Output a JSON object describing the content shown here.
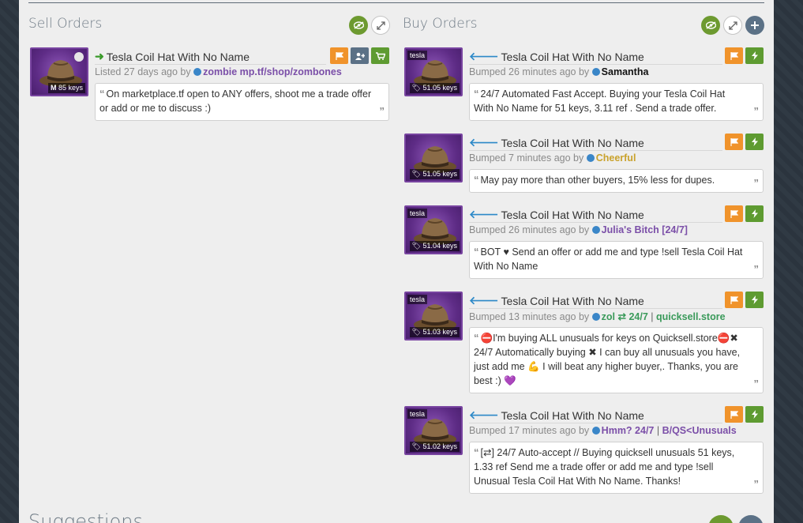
{
  "sell_orders": {
    "title": "Sell Orders",
    "listings": [
      {
        "item_name": "Tesla Coil Hat With No Name",
        "price": "85 keys",
        "price_prefix": "M",
        "status_prefix": "Listed 27 days ago by",
        "user": "zombie mp.tf/shop/zombones",
        "user_color": "#7b4fa8",
        "message": "On marketplace.tf open to ANY offers, shoot me a trade offer or add or me to discuss :)"
      }
    ]
  },
  "buy_orders": {
    "title": "Buy Orders",
    "listings": [
      {
        "tag": "tesla",
        "item_name": "Tesla Coil Hat With No Name",
        "price": "51.05 keys",
        "status_prefix": "Bumped 26 minutes ago by",
        "user": "Samantha",
        "user_color": "#111111",
        "message": "24/7 Automated Fast Accept. Buying your Tesla Coil Hat With No Name for 51 keys, 3.11 ref . Send a trade offer."
      },
      {
        "tag": "",
        "item_name": "Tesla Coil Hat With No Name",
        "price": "51.05 keys",
        "status_prefix": "Bumped 7 minutes ago by",
        "user": "Cheerful",
        "user_color": "#c9a22c",
        "message": "May pay more than other buyers, 15% less for dupes."
      },
      {
        "tag": "tesla",
        "item_name": "Tesla Coil Hat With No Name",
        "price": "51.04 keys",
        "status_prefix": "Bumped 26 minutes ago by",
        "user": "Julia's Bitch [24/7]",
        "user_color": "#7b4fa8",
        "message": "BOT ♥ Send an offer or add me and type !sell Tesla Coil Hat With No Name"
      },
      {
        "tag": "tesla",
        "item_name": "Tesla Coil Hat With No Name",
        "price": "51.03 keys",
        "status_prefix": "Bumped 13 minutes ago by",
        "user": "zol ⇄ 24/7",
        "user_extra_sep": " | ",
        "user_extra": "quicksell.store",
        "user_color": "#3a9a5a",
        "message": "⛔I'm buying ALL unusuals for keys on Quicksell.store⛔✖ 24/7 Automatically buying ✖ I can buy all unusuals you have, just add me 💪 I will beat any higher buyer,. Thanks, you are best :) 💜"
      },
      {
        "tag": "tesla",
        "item_name": "Tesla Coil Hat With No Name",
        "price": "51.02 keys",
        "status_prefix": "Bumped 17 minutes ago by",
        "user": "Hmm? 24/7",
        "user_extra_sep": " | ",
        "user_extra": "B/QS<Unusuals",
        "user_color": "#7b4fa8",
        "message": "[⇄] 24/7 Auto-accept // Buying quicksell unusuals 51 keys, 1.33 ref Send me a trade offer or add me and type !sell Unusual Tesla Coil Hat With No Name. Thanks!"
      }
    ]
  },
  "suggestions": {
    "title": "Suggestions"
  },
  "icons": {
    "hide": "eye-slash-icon",
    "expand": "expand-icon",
    "add": "plus-icon",
    "flag": "flag-icon",
    "add_friend": "user-plus-icon",
    "cart": "cart-icon",
    "bolt": "bolt-icon",
    "tag": "tag-icon",
    "quote_open": "“",
    "quote_close": "”"
  }
}
